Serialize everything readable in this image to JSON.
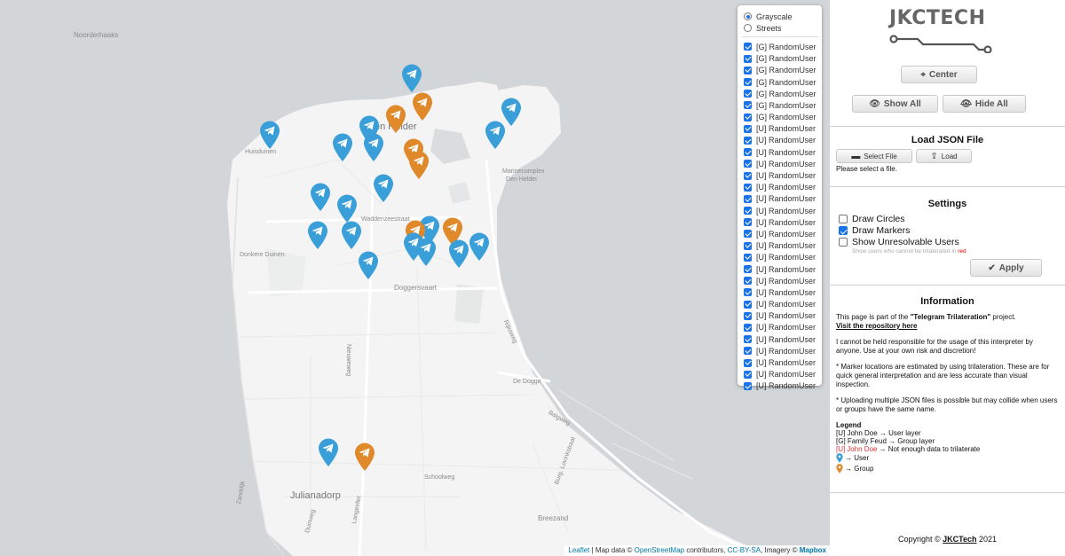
{
  "map": {
    "places": [
      {
        "id": "noorderhaaks",
        "text": "Noorderhaaks"
      },
      {
        "id": "den_helder",
        "text": "en Helder"
      },
      {
        "id": "huisduinen",
        "text": "Huisduinen"
      },
      {
        "id": "marinecomplex",
        "text": "Marinecomplex"
      },
      {
        "id": "marine_den_helder",
        "text": "Den Helder"
      },
      {
        "id": "waddenzeestraat",
        "text": "Waddenzeestraat"
      },
      {
        "id": "donkere_duinen",
        "text": "Donkere Duinen"
      },
      {
        "id": "doggersvaart",
        "text": "Doggersvaart"
      },
      {
        "id": "nieuweweg",
        "text": "Nieuweweg"
      },
      {
        "id": "rijksweg",
        "text": "Rijksweg"
      },
      {
        "id": "de_dogge",
        "text": "De Dogge"
      },
      {
        "id": "balgweg",
        "text": "Balgweg"
      },
      {
        "id": "burg_lovinkstraat",
        "text": "Burg. Lovinkstraat"
      },
      {
        "id": "schoolweg",
        "text": "Schoolweg"
      },
      {
        "id": "julianadorp",
        "text": "Julianadorp"
      },
      {
        "id": "breezand",
        "text": "Breezand"
      },
      {
        "id": "zanddijk",
        "text": "Zanddijk"
      },
      {
        "id": "langevliet",
        "text": "Langevliet"
      },
      {
        "id": "duinweg",
        "text": "Duinweg"
      }
    ],
    "marker_types": {
      "user": "#3a9fd8",
      "group": "#e0892a"
    },
    "layer_control": {
      "base_layers": [
        {
          "label": "Grayscale",
          "selected": true
        },
        {
          "label": "Streets",
          "selected": false
        }
      ],
      "overlays": [
        {
          "label": "[G] RandomUser",
          "checked": true
        },
        {
          "label": "[G] RandomUser",
          "checked": true
        },
        {
          "label": "[G] RandomUser",
          "checked": true
        },
        {
          "label": "[G] RandomUser",
          "checked": true
        },
        {
          "label": "[G] RandomUser",
          "checked": true
        },
        {
          "label": "[G] RandomUser",
          "checked": true
        },
        {
          "label": "[G] RandomUser",
          "checked": true
        },
        {
          "label": "[U] RandomUser",
          "checked": true
        },
        {
          "label": "[U] RandomUser",
          "checked": true
        },
        {
          "label": "[U] RandomUser",
          "checked": true
        },
        {
          "label": "[U] RandomUser",
          "checked": true
        },
        {
          "label": "[U] RandomUser",
          "checked": true
        },
        {
          "label": "[U] RandomUser",
          "checked": true
        },
        {
          "label": "[U] RandomUser",
          "checked": true
        },
        {
          "label": "[U] RandomUser",
          "checked": true
        },
        {
          "label": "[U] RandomUser",
          "checked": true
        },
        {
          "label": "[U] RandomUser",
          "checked": true
        },
        {
          "label": "[U] RandomUser",
          "checked": true
        },
        {
          "label": "[U] RandomUser",
          "checked": true
        },
        {
          "label": "[U] RandomUser",
          "checked": true
        },
        {
          "label": "[U] RandomUser",
          "checked": true
        },
        {
          "label": "[U] RandomUser",
          "checked": true
        },
        {
          "label": "[U] RandomUser",
          "checked": true
        },
        {
          "label": "[U] RandomUser",
          "checked": true
        },
        {
          "label": "[U] RandomUser",
          "checked": true
        },
        {
          "label": "[U] RandomUser",
          "checked": true
        },
        {
          "label": "[U] RandomUser",
          "checked": true
        },
        {
          "label": "[U] RandomUser",
          "checked": true
        },
        {
          "label": "[U] RandomUser",
          "checked": true
        },
        {
          "label": "[U] RandomUser",
          "checked": true
        }
      ]
    },
    "attribution": {
      "leaflet": "Leaflet",
      "sep1": " | Map data © ",
      "osm": "OpenStreetMap",
      "contributors": " contributors, ",
      "license": "CC-BY-SA",
      "imagery": ", Imagery © ",
      "mapbox": "Mapbox"
    }
  },
  "sidebar": {
    "logo_text": "JKCTECH",
    "center_label": "Center",
    "show_all_label": "Show All",
    "hide_all_label": "Hide All",
    "load_json": {
      "title": "Load JSON File",
      "select_file_label": "Select File",
      "load_label": "Load",
      "status": "Please select a file."
    },
    "settings": {
      "title": "Settings",
      "draw_circles": {
        "label": "Draw Circles",
        "checked": false
      },
      "draw_markers": {
        "label": "Draw Markers",
        "checked": true
      },
      "show_unresolvable": {
        "label": "Show Unresolvable Users",
        "checked": false
      },
      "hint_prefix": "Show users who cannot be trilaterated in ",
      "hint_red": "red",
      "hint_suffix": ".",
      "apply_label": "Apply"
    },
    "information": {
      "title": "Information",
      "p1_prefix": "This page is part of the ",
      "p1_project": "\"Telegram Trilateration\"",
      "p1_suffix": " project.",
      "repo_link": "Visit the repository here",
      "p2": "I cannot be held responsible for the usage of this interpreter by anyone. Use at your own risk and discretion!",
      "p3": "* Marker locations are estimated by using trilateration. These are for quick general interpretation and are less accurate than visual inspection.",
      "p4": "* Uploading multiple JSON files is possible but may collide when users or groups have the same name.",
      "legend_title": "Legend",
      "legend_user_layer": "[U] John Doe → User layer",
      "legend_group_layer": "[G] Family Feud → Group layer",
      "legend_red_prefix": "[U]",
      "legend_red_name": "John Doe",
      "legend_red_suffix": "→ Not enough data to trilaterate",
      "legend_user": "→ User",
      "legend_group": "→ Group"
    },
    "copyright_prefix": "Copyright © ",
    "copyright_name": "JKCTech",
    "copyright_year": " 2021"
  }
}
